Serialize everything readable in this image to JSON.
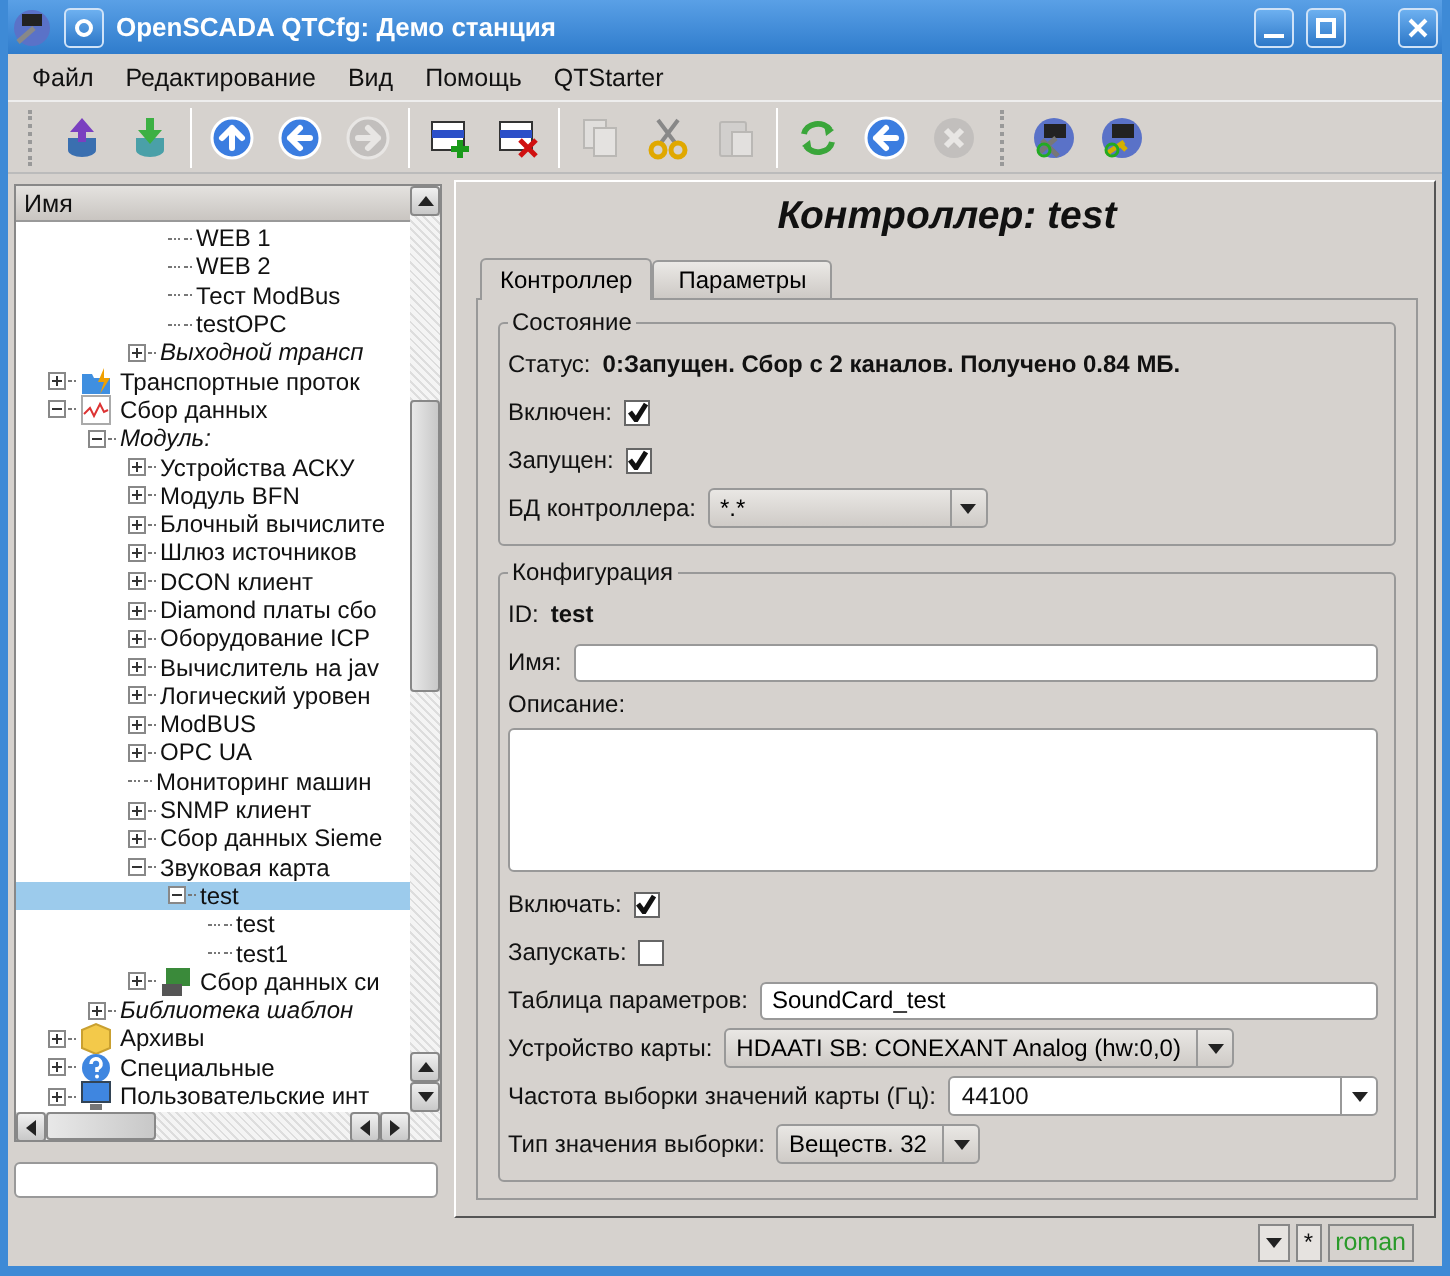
{
  "window": {
    "title": "OpenSCADA QTCfg: Демо станция"
  },
  "menu": [
    "Файл",
    "Редактирование",
    "Вид",
    "Помощь",
    "QTStarter"
  ],
  "toolbar": [
    [
      {
        "kind": "dbup",
        "disabled": false
      },
      {
        "kind": "dbdown",
        "disabled": false
      }
    ],
    [
      {
        "kind": "up",
        "disabled": false
      },
      {
        "kind": "back",
        "disabled": false
      },
      {
        "kind": "forward",
        "disabled": true
      }
    ],
    [
      {
        "kind": "add",
        "disabled": false
      },
      {
        "kind": "delete",
        "disabled": false
      }
    ],
    [
      {
        "kind": "copy",
        "disabled": true
      },
      {
        "kind": "cut",
        "disabled": false
      },
      {
        "kind": "paste",
        "disabled": true
      }
    ],
    [
      {
        "kind": "refresh",
        "disabled": false
      },
      {
        "kind": "back",
        "disabled": false
      },
      {
        "kind": "stop",
        "disabled": true
      }
    ],
    [
      {
        "kind": "station",
        "disabled": false
      },
      {
        "kind": "stationkey",
        "disabled": false
      }
    ]
  ],
  "tree": {
    "header": "Имя",
    "items": [
      {
        "children": [
          {
            "children": [
              {
                "children": [
                  {
                    "children": [
                      {
                        "label": "WEB 1",
                        "selected": false
                      },
                      {
                        "label": "WEB 2",
                        "selected": false
                      },
                      {
                        "label": "Тест ModBus",
                        "selected": false
                      },
                      {
                        "label": "testOPC",
                        "selected": false
                      }
                    ]
                  },
                  {
                    "label": "Выходной трансп",
                    "kind": "group",
                    "expanded": false,
                    "selected": false
                  }
                ]
              }
            ]
          },
          {
            "label": "Транспортные проток",
            "kind": "folder",
            "expanded": false,
            "selected": false
          },
          {
            "label": "Сбор данных",
            "kind": "chart",
            "expanded": true,
            "selected": false,
            "children": [
              {
                "label": "Модуль:",
                "kind": "group",
                "expanded": true,
                "selected": false,
                "children": [
                  {
                    "label": "Устройства АСКУ",
                    "expanded": false,
                    "selected": false
                  },
                  {
                    "label": "Модуль BFN",
                    "expanded": false,
                    "selected": false
                  },
                  {
                    "label": "Блочный вычислите",
                    "expanded": false,
                    "selected": false
                  },
                  {
                    "label": "Шлюз источников",
                    "expanded": false,
                    "selected": false
                  },
                  {
                    "label": "DCON клиент",
                    "expanded": false,
                    "selected": false
                  },
                  {
                    "label": "Diamond платы сбо",
                    "expanded": false,
                    "selected": false
                  },
                  {
                    "label": "Оборудование ICP",
                    "expanded": false,
                    "selected": false
                  },
                  {
                    "label": "Вычислитель на jav",
                    "expanded": false,
                    "selected": false
                  },
                  {
                    "label": "Логический уровен",
                    "expanded": false,
                    "selected": false
                  },
                  {
                    "label": "ModBUS",
                    "expanded": false,
                    "selected": false
                  },
                  {
                    "label": "OPC UA",
                    "expanded": false,
                    "selected": false
                  },
                  {
                    "label": "Мониторинг машин",
                    "selected": false
                  },
                  {
                    "label": "SNMP клиент",
                    "expanded": false,
                    "selected": false
                  },
                  {
                    "label": "Сбор данных Sieme",
                    "expanded": false,
                    "selected": false
                  },
                  {
                    "label": "Звуковая карта",
                    "expanded": true,
                    "selected": false,
                    "children": [
                      {
                        "label": "test",
                        "expanded": true,
                        "selected": true,
                        "children": [
                          {
                            "label": "test",
                            "selected": false
                          },
                          {
                            "label": "test1",
                            "selected": false
                          }
                        ]
                      }
                    ]
                  },
                  {
                    "label": "Сбор данных си",
                    "kind": "device",
                    "expanded": false,
                    "selected": false
                  }
                ]
              },
              {
                "label": "Библиотека шаблон",
                "kind": "group",
                "expanded": false,
                "selected": false
              }
            ]
          },
          {
            "label": "Архивы",
            "kind": "box",
            "expanded": false,
            "selected": false
          },
          {
            "label": "Специальные",
            "kind": "question",
            "expanded": false,
            "selected": false
          },
          {
            "label": "Пользовательские инт",
            "kind": "monitor",
            "expanded": false,
            "selected": false
          }
        ]
      }
    ]
  },
  "page": {
    "title": "Контроллер: test",
    "tabs": [
      {
        "label": "Контроллер",
        "selected": true
      },
      {
        "label": "Параметры",
        "selected": false
      }
    ],
    "groups": [
      {
        "title": "Состояние",
        "fields": [
          {
            "kind": "status",
            "label": "Статус:",
            "value": "0:Запущен. Сбор с 2 каналов. Получено 0.84 МБ."
          },
          {
            "kind": "checkbox",
            "label": "Включен:",
            "checked": true
          },
          {
            "kind": "checkbox",
            "label": "Запущен:",
            "checked": true
          },
          {
            "kind": "select",
            "label": "БД контроллера:",
            "value": "*.*"
          }
        ]
      },
      {
        "title": "Конфигурация",
        "fields": [
          {
            "kind": "status",
            "label": "ID:",
            "value": "test"
          },
          {
            "kind": "text",
            "label": "Имя:"
          },
          {
            "kind": "textarea",
            "label": "Описание:"
          },
          {
            "kind": "checkbox",
            "label": "Включать:",
            "checked": true
          },
          {
            "kind": "checkbox",
            "label": "Запускать:",
            "checked": false
          },
          {
            "kind": "text",
            "label": "Таблица параметров:",
            "value": "SoundCard_test"
          },
          {
            "kind": "select",
            "label": "Устройство карты:",
            "value": "HDAATI SB: CONEXANT Analog (hw:0,0)"
          },
          {
            "kind": "combo",
            "label": "Частота выборки значений карты (Гц):",
            "value": "44100"
          },
          {
            "kind": "select",
            "label": "Тип значения выборки:",
            "value": "Веществ. 32"
          }
        ]
      }
    ]
  },
  "status_bar": {
    "mark": "*",
    "user": "roman"
  }
}
